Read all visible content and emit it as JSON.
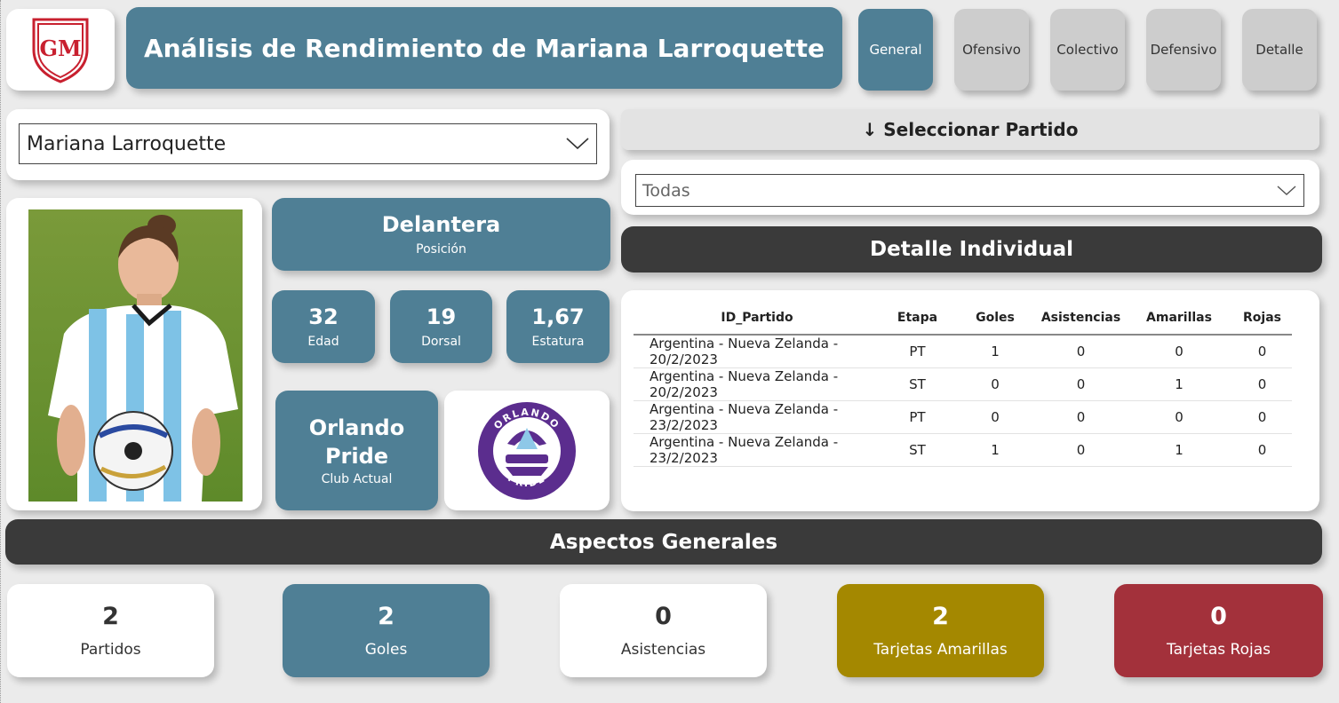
{
  "header": {
    "title": "Análisis de Rendimiento de Mariana Larroquette",
    "logo_text": "GM"
  },
  "nav": {
    "tabs": [
      {
        "label": "General",
        "active": true
      },
      {
        "label": "Ofensivo",
        "active": false
      },
      {
        "label": "Colectivo",
        "active": false
      },
      {
        "label": "Defensivo",
        "active": false
      },
      {
        "label": "Detalle",
        "active": false
      }
    ]
  },
  "player_select": {
    "value": "Mariana Larroquette"
  },
  "match_filter": {
    "header": "↓ Seleccionar Partido",
    "value": "Todas"
  },
  "detail": {
    "title": "Detalle Individual",
    "columns": [
      "ID_Partido",
      "Etapa",
      "Goles",
      "Asistencias",
      "Amarillas",
      "Rojas"
    ],
    "rows": [
      [
        "Argentina - Nueva Zelanda - 20/2/2023",
        "PT",
        "1",
        "0",
        "0",
        "0"
      ],
      [
        "Argentina - Nueva Zelanda - 20/2/2023",
        "ST",
        "0",
        "0",
        "1",
        "0"
      ],
      [
        "Argentina - Nueva Zelanda - 23/2/2023",
        "PT",
        "0",
        "0",
        "0",
        "0"
      ],
      [
        "Argentina - Nueva Zelanda - 23/2/2023",
        "ST",
        "1",
        "0",
        "1",
        "0"
      ]
    ]
  },
  "profile": {
    "position": {
      "value": "Delantera",
      "label": "Posición"
    },
    "age": {
      "value": "32",
      "label": "Edad"
    },
    "dorsal": {
      "value": "19",
      "label": "Dorsal"
    },
    "height": {
      "value": "1,67",
      "label": "Estatura"
    },
    "club": {
      "value_line1": "Orlando",
      "value_line2": "Pride",
      "label": "Club Actual"
    },
    "club_logo_text_top": "ORLANDO",
    "club_logo_text_bottom": "PRIDE"
  },
  "general": {
    "title": "Aspectos Generales",
    "kpis": {
      "partidos": {
        "value": "2",
        "label": "Partidos"
      },
      "goles": {
        "value": "2",
        "label": "Goles"
      },
      "asistencias": {
        "value": "0",
        "label": "Asistencias"
      },
      "amarillas": {
        "value": "2",
        "label": "Tarjetas Amarillas"
      },
      "rojas": {
        "value": "0",
        "label": "Tarjetas Rojas"
      }
    }
  },
  "colors": {
    "teal": "#4f7f95",
    "dark": "#3a3a3a",
    "yellow_card": "#a48800",
    "red_card": "#a3313b",
    "logo_red": "#c8202f",
    "club_purple": "#5b2d8e"
  }
}
